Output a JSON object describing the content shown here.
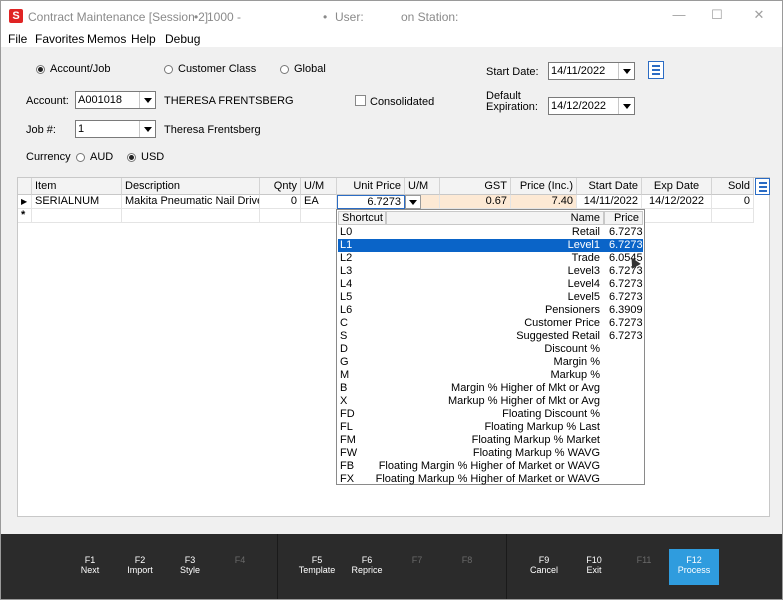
{
  "window": {
    "title_app": "Contract Maintenance [Session 2]",
    "title_id": "1000 -",
    "title_user": "User:",
    "title_station": "on Station:",
    "app_icon": "S"
  },
  "menu": [
    "File",
    "Favorites",
    "Memos",
    "Help",
    "Debug"
  ],
  "scope": {
    "options": [
      "Account/Job",
      "Customer Class",
      "Global"
    ],
    "selected": "Account/Job"
  },
  "dates": {
    "start_label": "Start Date:",
    "start_value": "14/11/2022",
    "expiry_label_1": "Default",
    "expiry_label_2": "Expiration:",
    "expiry_value": "14/12/2022"
  },
  "account": {
    "label": "Account:",
    "code": "A001018",
    "name": "THERESA FRENTSBERG",
    "consolidated_label": "Consolidated",
    "consolidated_checked": false
  },
  "job": {
    "label": "Job #:",
    "value": "1",
    "name": "Theresa Frentsberg"
  },
  "currency": {
    "label": "Currency",
    "options": [
      "AUD",
      "USD"
    ],
    "selected": "USD"
  },
  "grid": {
    "columns": [
      "Item",
      "Description",
      "Qnty",
      "U/M",
      "Unit Price",
      "U/M",
      "GST",
      "Price (Inc.)",
      "Start Date",
      "Exp Date",
      "Sold"
    ],
    "rows": [
      {
        "item": "SERIALNUM",
        "description": "Makita Pneumatic Nail Driver",
        "qnty": "0",
        "um": "EA",
        "unit_price": "6.7273",
        "gst": "0.67",
        "price_inc": "7.40",
        "start": "14/11/2022",
        "exp": "14/12/2022",
        "sold": "0"
      }
    ],
    "new_row_marker": "*"
  },
  "price_dropdown": {
    "headers": [
      "Shortcut",
      "Name",
      "Price"
    ],
    "selected_index": 1,
    "rows": [
      {
        "s": "L0",
        "n": "Retail",
        "p": "6.7273"
      },
      {
        "s": "L1",
        "n": "Level1",
        "p": "6.7273"
      },
      {
        "s": "L2",
        "n": "Trade",
        "p": "6.0545"
      },
      {
        "s": "L3",
        "n": "Level3",
        "p": "6.7273"
      },
      {
        "s": "L4",
        "n": "Level4",
        "p": "6.7273"
      },
      {
        "s": "L5",
        "n": "Level5",
        "p": "6.7273"
      },
      {
        "s": "L6",
        "n": "Pensioners",
        "p": "6.3909"
      },
      {
        "s": "C",
        "n": "Customer Price",
        "p": "6.7273"
      },
      {
        "s": "S",
        "n": "Suggested Retail",
        "p": "6.7273"
      },
      {
        "s": "D",
        "n": "Discount %",
        "p": ""
      },
      {
        "s": "G",
        "n": "Margin %",
        "p": ""
      },
      {
        "s": "M",
        "n": "Markup %",
        "p": ""
      },
      {
        "s": "B",
        "n": "Margin % Higher of Mkt or Avg",
        "p": ""
      },
      {
        "s": "X",
        "n": "Markup % Higher of Mkt or Avg",
        "p": ""
      },
      {
        "s": "FD",
        "n": "Floating Discount %",
        "p": ""
      },
      {
        "s": "FL",
        "n": "Floating Markup % Last",
        "p": ""
      },
      {
        "s": "FM",
        "n": "Floating Markup % Market",
        "p": ""
      },
      {
        "s": "FW",
        "n": "Floating Markup % WAVG",
        "p": ""
      },
      {
        "s": "FB",
        "n": "Floating Margin % Higher of Market or WAVG",
        "p": ""
      },
      {
        "s": "FX",
        "n": "Floating Markup % Higher of Market or WAVG",
        "p": ""
      }
    ]
  },
  "fkeys": [
    {
      "key": "F1",
      "label": "Next",
      "state": "enabled"
    },
    {
      "key": "F2",
      "label": "Import",
      "state": "enabled"
    },
    {
      "key": "F3",
      "label": "Style",
      "state": "enabled"
    },
    {
      "key": "F4",
      "label": "",
      "state": "disabled"
    },
    {
      "key": "F5",
      "label": "Template",
      "state": "enabled"
    },
    {
      "key": "F6",
      "label": "Reprice",
      "state": "enabled"
    },
    {
      "key": "F7",
      "label": "",
      "state": "disabled"
    },
    {
      "key": "F8",
      "label": "",
      "state": "disabled"
    },
    {
      "key": "F9",
      "label": "Cancel",
      "state": "enabled"
    },
    {
      "key": "F10",
      "label": "Exit",
      "state": "enabled"
    },
    {
      "key": "F11",
      "label": "",
      "state": "disabled"
    },
    {
      "key": "F12",
      "label": "Process",
      "state": "active"
    }
  ],
  "colors": {
    "selection": "#0a64c8",
    "active_fkey": "#2f9cde",
    "price_highlight": "#fde9d4",
    "app_icon": "#e02424"
  }
}
